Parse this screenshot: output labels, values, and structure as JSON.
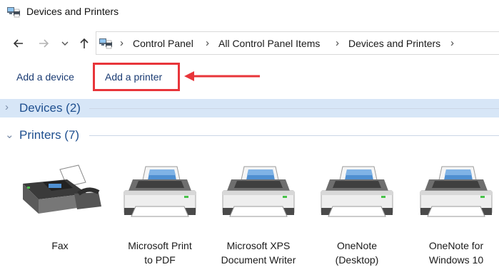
{
  "window": {
    "title": "Devices and Printers"
  },
  "address_bar": {
    "breadcrumbs": [
      "Control Panel",
      "All Control Panel Items",
      "Devices and Printers"
    ]
  },
  "command_bar": {
    "add_device_label": "Add a device",
    "add_printer_label": "Add a printer"
  },
  "groups": {
    "devices": {
      "label": "Devices (2)",
      "expanded": false
    },
    "printers": {
      "label": "Printers (7)",
      "expanded": true
    }
  },
  "printers": [
    {
      "line1": "Fax",
      "line2": "",
      "icon": "fax-icon"
    },
    {
      "line1": "Microsoft Print",
      "line2": "to PDF",
      "icon": "printer-icon"
    },
    {
      "line1": "Microsoft XPS",
      "line2": "Document Writer",
      "icon": "printer-icon"
    },
    {
      "line1": "OneNote",
      "line2": "(Desktop)",
      "icon": "printer-icon"
    },
    {
      "line1": "OneNote for",
      "line2": "Windows 10",
      "icon": "printer-icon"
    }
  ],
  "colors": {
    "annotation_red": "#e8353a",
    "link_blue": "#1e4f8f",
    "group_highlight": "#d7e6f7"
  }
}
